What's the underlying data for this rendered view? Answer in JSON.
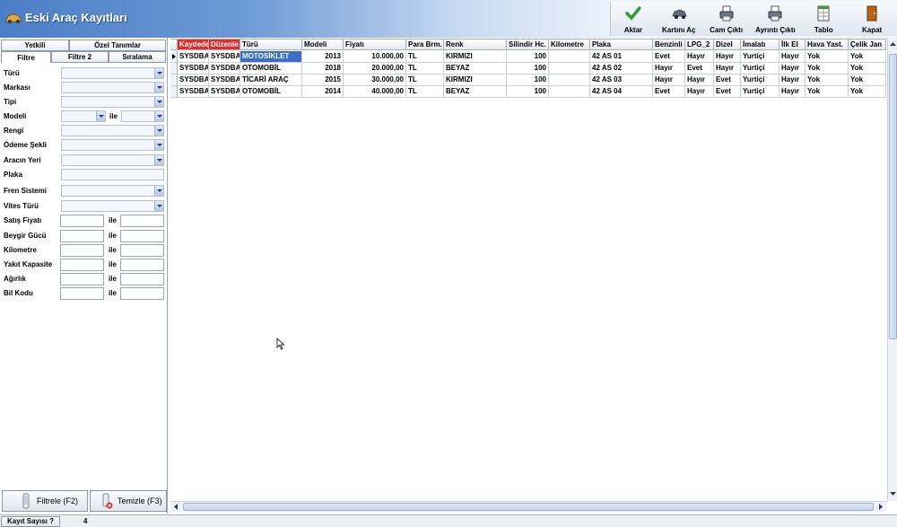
{
  "window": {
    "title": "Eski Araç Kayıtları"
  },
  "toolbar": [
    {
      "label": "Aktar",
      "icon": "check-icon"
    },
    {
      "label": "Kartını Aç",
      "icon": "car-icon"
    },
    {
      "label": "Cam Çıktı",
      "icon": "printer-icon"
    },
    {
      "label": "Ayrıntı Çıktı",
      "icon": "printer-icon"
    },
    {
      "label": "Tablo",
      "icon": "table-icon"
    },
    {
      "label": "Kapat",
      "icon": "door-exit-icon"
    }
  ],
  "left_tabs": {
    "row1": [
      "Yetkili",
      "Özel Tanımlar"
    ],
    "row2": [
      "Filtre",
      "Filtre 2",
      "Sıralama"
    ]
  },
  "filters": {
    "turu": "Türü",
    "markasi": "Markası",
    "tipi": "Tipi",
    "modeli": "Modeli",
    "rengi": "Rengi",
    "odeme": "Ödeme Şekli",
    "yeri": "Aracın Yeri",
    "plaka": "Plaka",
    "fren": "Fren Sistemi",
    "vites": "Vites Türü",
    "satis": "Satış Fiyatı",
    "beygir": "Beygir Gücü",
    "kilometre": "Kilometre",
    "yakit": "Yakıt Kapasite",
    "agirlik": "Ağırlık",
    "bilkodu": "Bil Kodu",
    "ile": "ile"
  },
  "buttons": {
    "filtrele": "Filtrele (F2)",
    "temizle": "Temizle (F3)"
  },
  "grid": {
    "columns": [
      "Kaydede",
      "Düzenle",
      "Türü",
      "Modeli",
      "Fiyatı",
      "Para Brm.",
      "Renk",
      "Silindir Hc.",
      "Kilometre",
      "Plaka",
      "Benzinli",
      "LPG_2",
      "Dizel",
      "İmalatı",
      "İlk El",
      "Hava Yast.",
      "Çelik Jan"
    ],
    "rows": [
      [
        "SYSDBA",
        "SYSDBA",
        "MOTOSİKLET",
        "2013",
        "10.000,00",
        "TL",
        "KIRMIZI",
        "100",
        "",
        "42 AS 01",
        "Evet",
        "Hayır",
        "Hayır",
        "Yurtiçi",
        "Hayır",
        "Yok",
        "Yok"
      ],
      [
        "SYSDBA",
        "SYSDBA",
        "OTOMOBİL",
        "2018",
        "20.000,00",
        "TL",
        "BEYAZ",
        "100",
        "",
        "42 AS 02",
        "Hayır",
        "Evet",
        "Hayır",
        "Yurtiçi",
        "Hayır",
        "Yok",
        "Yok"
      ],
      [
        "SYSDBA",
        "SYSDBA",
        "TİCARİ ARAÇ",
        "2015",
        "30.000,00",
        "TL",
        "KIRMIZI",
        "100",
        "",
        "42 AS 03",
        "Hayır",
        "Hayır",
        "Evet",
        "Yurtiçi",
        "Hayır",
        "Yok",
        "Yok"
      ],
      [
        "SYSDBA",
        "SYSDBA",
        "OTOMOBİL",
        "2014",
        "40.000,00",
        "TL",
        "BEYAZ",
        "100",
        "",
        "42 AS 04",
        "Evet",
        "Hayır",
        "Evet",
        "Yurtiçi",
        "Hayır",
        "Yok",
        "Yok"
      ]
    ]
  },
  "status": {
    "label": "Kayıt Sayısı ?",
    "count": "4"
  }
}
